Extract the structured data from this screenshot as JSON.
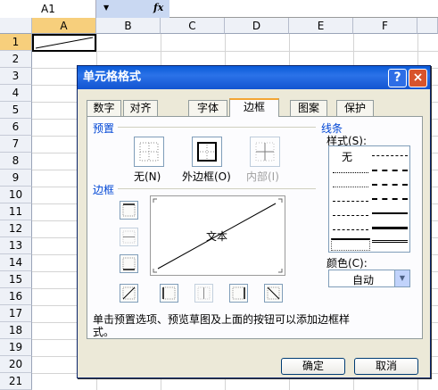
{
  "namebox": {
    "cell": "A1",
    "fx": "fx"
  },
  "columns": [
    "A",
    "B",
    "C",
    "D",
    "E",
    "F"
  ],
  "rows": [
    "1",
    "2",
    "3",
    "4",
    "5",
    "6",
    "7",
    "8",
    "9",
    "10",
    "11",
    "12",
    "13",
    "14",
    "15",
    "16",
    "17",
    "18",
    "19",
    "20",
    "21"
  ],
  "dialog": {
    "title": "单元格格式",
    "help": "?",
    "close": "×",
    "tabs": [
      "数字",
      "对齐",
      "字体",
      "边框",
      "图案",
      "保护"
    ],
    "active_tab": "边框",
    "preset_title": "预置",
    "presets": [
      "无(N)",
      "外边框(O)",
      "内部(I)"
    ],
    "border_title": "边框",
    "preview_text": "文本",
    "line_title": "线条",
    "style_label": "样式(S):",
    "style_none": "无",
    "color_label": "颜色(C):",
    "color_value": "自动",
    "note": "单击预置选项、预览草图及上面的按钮可以添加边框样式。",
    "ok": "确定",
    "cancel": "取消"
  }
}
